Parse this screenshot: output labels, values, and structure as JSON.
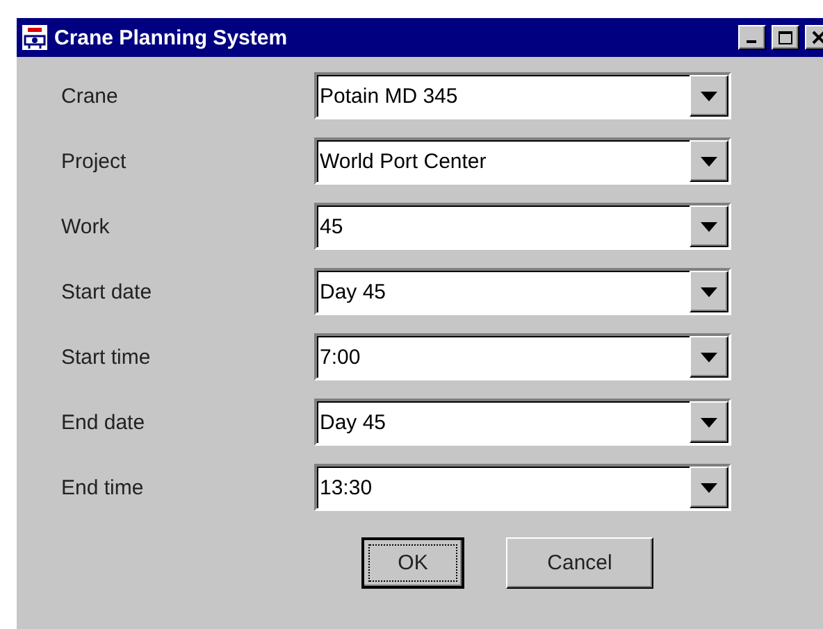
{
  "window": {
    "title": "Crane Planning System"
  },
  "fields": [
    {
      "label": "Crane",
      "value": "Potain MD 345"
    },
    {
      "label": "Project",
      "value": "World Port Center"
    },
    {
      "label": "Work",
      "value": "45"
    },
    {
      "label": "Start date",
      "value": "Day 45"
    },
    {
      "label": "Start time",
      "value": "7:00"
    },
    {
      "label": "End date",
      "value": "Day 45"
    },
    {
      "label": "End time",
      "value": "13:30"
    }
  ],
  "buttons": [
    {
      "label": "OK",
      "focused": true
    },
    {
      "label": "Cancel",
      "focused": false
    }
  ]
}
